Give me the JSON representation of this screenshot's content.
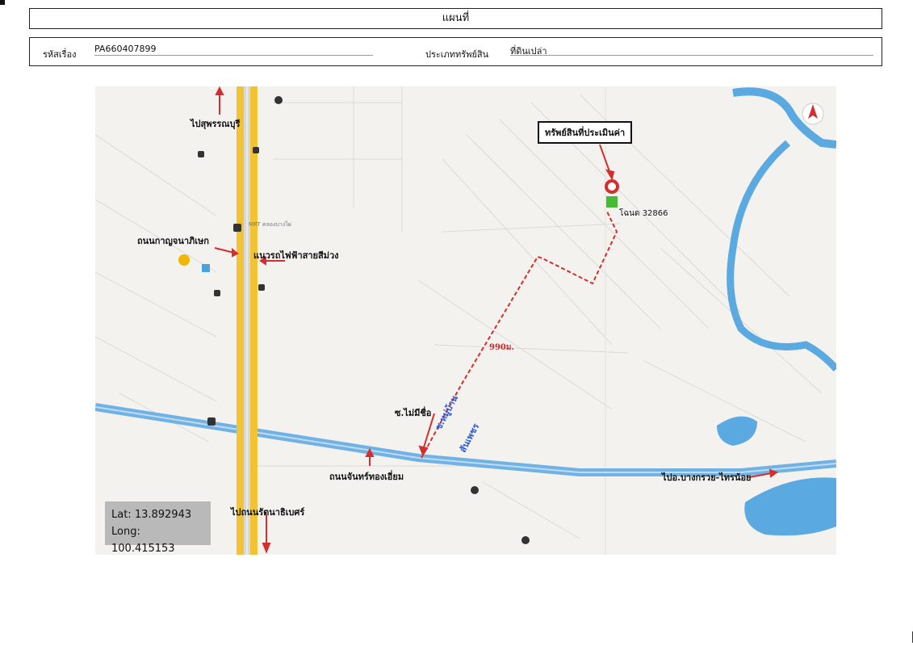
{
  "header": {
    "title": "แผนที่"
  },
  "info": {
    "case_label": "รหัสเรื่อง",
    "case_value": "PA660407899",
    "type_label": "ประเภททรัพย์สิน",
    "type_value": "ที่ดินเปล่า"
  },
  "map": {
    "property_label": "ทรัพย์สินที่ประเมินค่า",
    "deed_label": "โฉนด 32866",
    "distance_label": "990ม.",
    "to_suphanburi": "ไปสุพรรณบุรี",
    "kanchana_road": "ถนนกาญจนาภิเษก",
    "purple_line": "แนวรถไฟฟ้าสายสีม่วง",
    "unnamed_soi": "ซ.ไม่มีชื่อ",
    "soi_name": "ซ.หมู่บ้าน",
    "soi_name2": "สันเพชร",
    "chanthong_road": "ถนนจันทร์ทองเอี่ยม",
    "to_bangkruai": "ไปอ.บางกรวย-ไทรน้อย",
    "to_rattanathibet": "ไปถนนรัตนาธิเบศร์",
    "coords": {
      "lat": "Lat: 13.892943",
      "long": "Long: 100.415153"
    },
    "station_label": "MRT คลองบางไผ่",
    "north_icon": "north-arrow-icon",
    "colors": {
      "road": "#f2c433",
      "water": "#5aa9e0",
      "route": "#d32f2f",
      "marker": "#d32f2f",
      "parcel": "#44bb33"
    }
  }
}
